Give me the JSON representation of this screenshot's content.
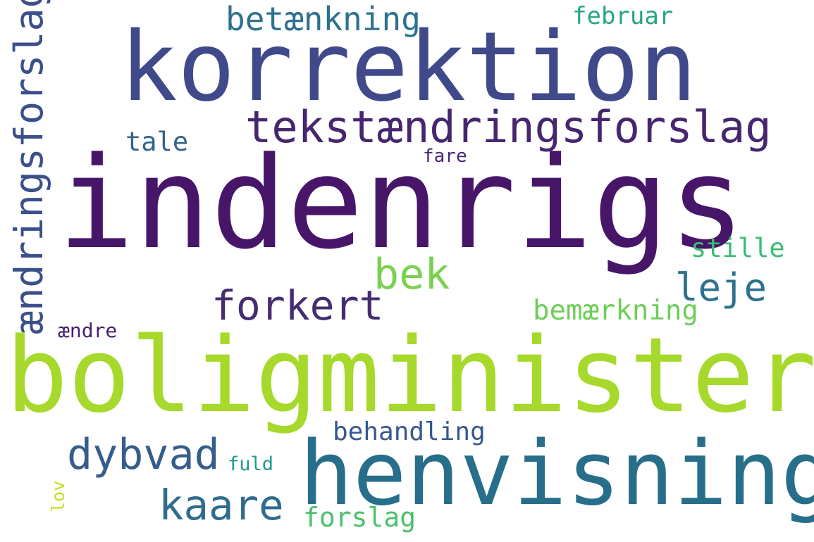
{
  "words": [
    {
      "id": "indenrigs",
      "text": "indenrigs",
      "color": "#471669"
    },
    {
      "id": "boligminister",
      "text": "boligminister",
      "color": "#a6d92b"
    },
    {
      "id": "korrektion",
      "text": "korrektion",
      "color": "#404a8a"
    },
    {
      "id": "henvisning",
      "text": "henvisning",
      "color": "#276e8a"
    },
    {
      "id": "tekstaendringsforslag",
      "text": "tekstændringsforslag",
      "color": "#46266e"
    },
    {
      "id": "aendringsforslag",
      "text": "ændringsforslag",
      "color": "#3b4f8a"
    },
    {
      "id": "forkert",
      "text": "forkert",
      "color": "#452d70"
    },
    {
      "id": "dybvad",
      "text": "dybvad",
      "color": "#355d8c"
    },
    {
      "id": "kaare",
      "text": "kaare",
      "color": "#2f6c8e"
    },
    {
      "id": "betaenkning",
      "text": "betænkning",
      "color": "#2d718e"
    },
    {
      "id": "bek",
      "text": "bek",
      "color": "#7ad151"
    },
    {
      "id": "leje",
      "text": "leje",
      "color": "#2c728e"
    },
    {
      "id": "forslag",
      "text": "forslag",
      "color": "#4ac16d"
    },
    {
      "id": "behandling",
      "text": "behandling",
      "color": "#38588c"
    },
    {
      "id": "bemaerkning",
      "text": "bemærkning",
      "color": "#6ece58"
    },
    {
      "id": "stille",
      "text": "stille",
      "color": "#3bbb75"
    },
    {
      "id": "februar",
      "text": "februar",
      "color": "#26a585"
    },
    {
      "id": "tale",
      "text": "tale",
      "color": "#33638d"
    },
    {
      "id": "fare",
      "text": "fare",
      "color": "#482677"
    },
    {
      "id": "aendre",
      "text": "ændre",
      "color": "#481f70"
    },
    {
      "id": "fuld",
      "text": "fuld",
      "color": "#1f9a8a"
    },
    {
      "id": "lov",
      "text": "lov",
      "color": "#c2df23"
    }
  ]
}
